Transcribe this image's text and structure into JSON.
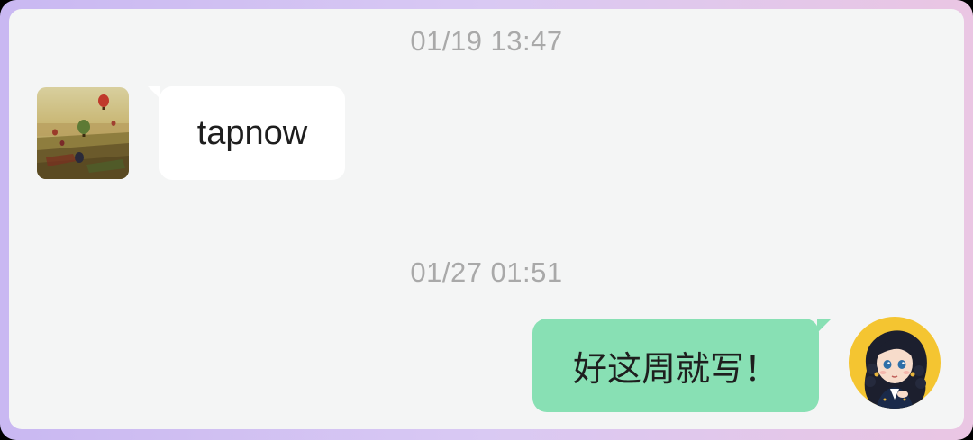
{
  "messages": [
    {
      "timestamp": "01/19 13:47",
      "direction": "incoming",
      "text": "tapnow",
      "avatar_icon": "hot-air-balloon-landscape-avatar"
    },
    {
      "timestamp": "01/27 01:51",
      "direction": "outgoing",
      "text": "好这周就写！",
      "avatar_icon": "cartoon-girl-avatar"
    }
  ],
  "colors": {
    "chat_background": "#f4f5f5",
    "incoming_bubble": "#ffffff",
    "outgoing_bubble": "#88e0b4",
    "timestamp_text": "#a9a9a9",
    "frame_gradient": [
      "#c9b8f2",
      "#eac6e3"
    ]
  }
}
